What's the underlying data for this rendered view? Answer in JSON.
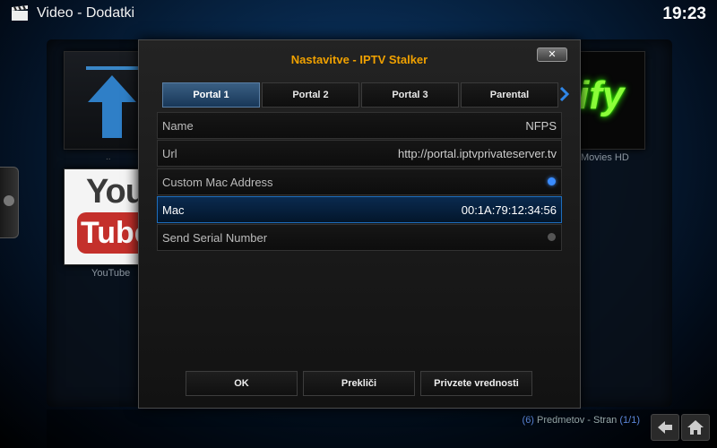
{
  "header": {
    "breadcrumb": "Video  - Dodatki",
    "clock": "19:23",
    "icon": "clapperboard-icon"
  },
  "background": {
    "tiles": [
      {
        "label": "..",
        "icon": "up-arrow-icon"
      },
      {
        "label": "YouTube",
        "logo_text_top": "You",
        "logo_text_bottom": "Tube"
      },
      {
        "label": "Movies HD",
        "logo_text": "ify"
      }
    ],
    "footer": {
      "count": "(6)",
      "items_text": "Predmetov - Stran",
      "page": "(1/1)"
    }
  },
  "dialog": {
    "title": "Nastavitve - IPTV Stalker",
    "close_label": "✕",
    "tabs": [
      "Portal 1",
      "Portal 2",
      "Portal 3",
      "Parental"
    ],
    "active_tab": "Portal 1",
    "settings": [
      {
        "label": "Name",
        "value": "NFPS"
      },
      {
        "label": "Url",
        "value": "http://portal.iptvprivateserver.tv"
      },
      {
        "label": "Custom Mac Address",
        "toggle": "on"
      },
      {
        "label": "Mac",
        "value": "00:1A:79:12:34:56",
        "focused": true
      },
      {
        "label": "Send Serial Number",
        "toggle": "off"
      }
    ],
    "buttons": {
      "ok": "OK",
      "cancel": "Prekliči",
      "defaults": "Privzete vrednosti"
    }
  },
  "colors": {
    "title_accent": "#f0a100",
    "focus_blue": "#1e6ebd",
    "toggle_on": "#3a8cff"
  }
}
